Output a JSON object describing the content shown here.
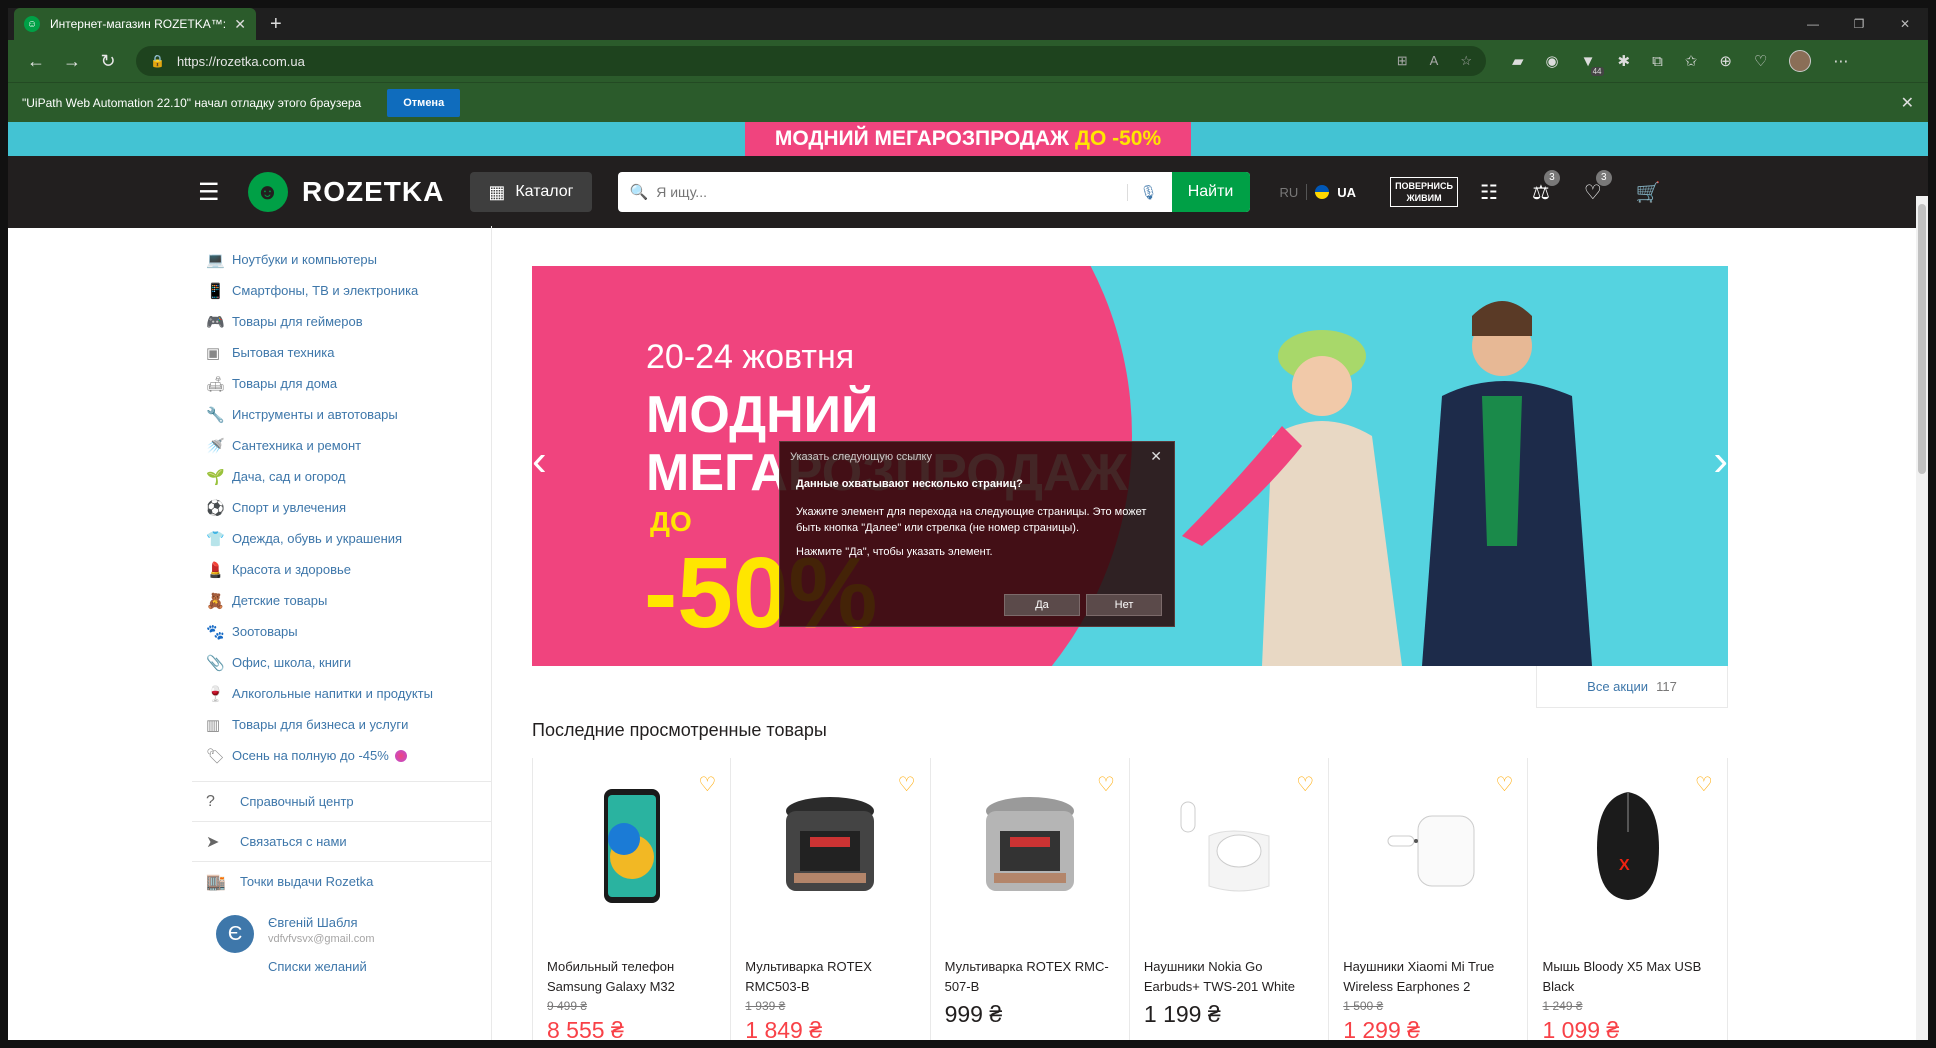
{
  "browser": {
    "tab_title": "Интернет-магазин ROZETKA™: о",
    "url": "https://rozetka.com.ua",
    "infobar_text": "\"UiPath Web Automation 22.10\" начал отладку этого браузера",
    "infobar_cancel": "Отмена",
    "ext_badge": "44"
  },
  "promo_strip": {
    "text": "МОДНИЙ МЕГАРОЗПРОДАЖ",
    "highlight": "ДО -50%"
  },
  "header": {
    "logo": "ROZETKA",
    "catalog": "Каталог",
    "search_placeholder": "Я ищу...",
    "search_button": "Найти",
    "lang_ru": "RU",
    "lang_ua": "UA",
    "badge_line1": "ПОВЕРНИСЬ",
    "badge_line2": "ЖИВИМ",
    "compare_count": "3",
    "wishlist_count": "3"
  },
  "sidebar": {
    "categories": [
      "Ноутбуки и компьютеры",
      "Смартфоны, ТВ и электроника",
      "Товары для геймеров",
      "Бытовая техника",
      "Товары для дома",
      "Инструменты и автотовары",
      "Сантехника и ремонт",
      "Дача, сад и огород",
      "Спорт и увлечения",
      "Одежда, обувь и украшения",
      "Красота и здоровье",
      "Детские товары",
      "Зоотовары",
      "Офис, школа, книги",
      "Алкогольные напитки и продукты",
      "Товары для бизнеса и услуги",
      "Осень на полную до -45%"
    ],
    "links": [
      "Справочный центр",
      "Связаться с нами",
      "Точки выдачи Rozetka"
    ],
    "user": {
      "initial": "Є",
      "name": "Євгеній Шабля",
      "email": "vdfvfvsvx@gmail.com",
      "wishlists": "Списки желаний"
    }
  },
  "banner": {
    "dates": "20-24 жовтня",
    "line1": "МОДНИЙ",
    "line2": "МЕГАРОЗПРОДАЖ",
    "do": "ДО",
    "percent": "-50%",
    "all_promos": "Все акции",
    "all_promos_count": "117"
  },
  "recent": {
    "title": "Последние просмотренные товары",
    "products": [
      {
        "name": "Мобильный телефон Samsung Galaxy M32",
        "old": "9 499 ₴",
        "price": "8 555 ₴",
        "discount": true
      },
      {
        "name": "Мультиварка ROTEX RMC503-B",
        "old": "1 939 ₴",
        "price": "1 849 ₴",
        "discount": true
      },
      {
        "name": "Мультиварка ROTEX RMC-507-B",
        "old": "",
        "price": "999 ₴",
        "discount": false
      },
      {
        "name": "Наушники Nokia Go Earbuds+ TWS-201 White",
        "old": "",
        "price": "1 199 ₴",
        "discount": false
      },
      {
        "name": "Наушники Xiaomi Mi True Wireless Earphones 2",
        "old": "1 500 ₴",
        "price": "1 299 ₴",
        "discount": true
      },
      {
        "name": "Мышь Bloody X5 Max USB Black",
        "old": "1 249 ₴",
        "price": "1 099 ₴",
        "discount": true
      }
    ]
  },
  "dialog": {
    "title": "Указать следующую ссылку",
    "question": "Данные охватывают несколько страниц?",
    "text": "Укажите элемент для перехода на следующие страницы. Это может быть кнопка \"Далее\" или стрелка (не номер страницы).",
    "hint": "Нажмите \"Да\", чтобы указать элемент.",
    "yes": "Да",
    "no": "Нет"
  }
}
